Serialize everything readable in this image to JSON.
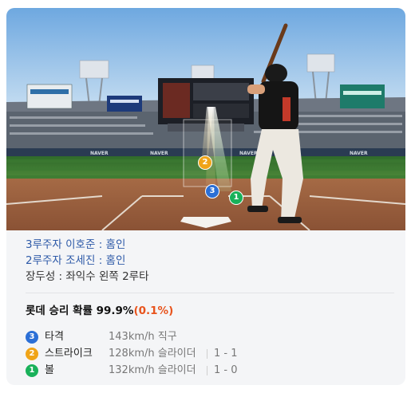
{
  "scene": {
    "pitches": [
      {
        "number": "3",
        "color": "#2b6fd6"
      },
      {
        "number": "2",
        "color": "#f0a418"
      },
      {
        "number": "1",
        "color": "#19b15a"
      }
    ],
    "billboards": {
      "ad_board_text": "NAVER"
    }
  },
  "plays": [
    {
      "text": "3루주자 이호준 : 홈인",
      "style": "blue"
    },
    {
      "text": "2루주자 조세진 : 홈인",
      "style": "blue"
    },
    {
      "text": "장두성 : 좌익수 왼쪽 2루타",
      "style": "dark"
    }
  ],
  "win_probability": {
    "label": "롯데 승리 확률",
    "value": "99.9%",
    "change": "(0.1%)"
  },
  "pitch_log": [
    {
      "number": "3",
      "color": "#2b6fd6",
      "result": "타격",
      "detail": "143km/h 직구",
      "count": ""
    },
    {
      "number": "2",
      "color": "#f0a418",
      "result": "스트라이크",
      "detail": "128km/h 슬라이더",
      "count": "1 - 1"
    },
    {
      "number": "1",
      "color": "#19b15a",
      "result": "볼",
      "detail": "132km/h 슬라이더",
      "count": "1 - 0"
    }
  ]
}
